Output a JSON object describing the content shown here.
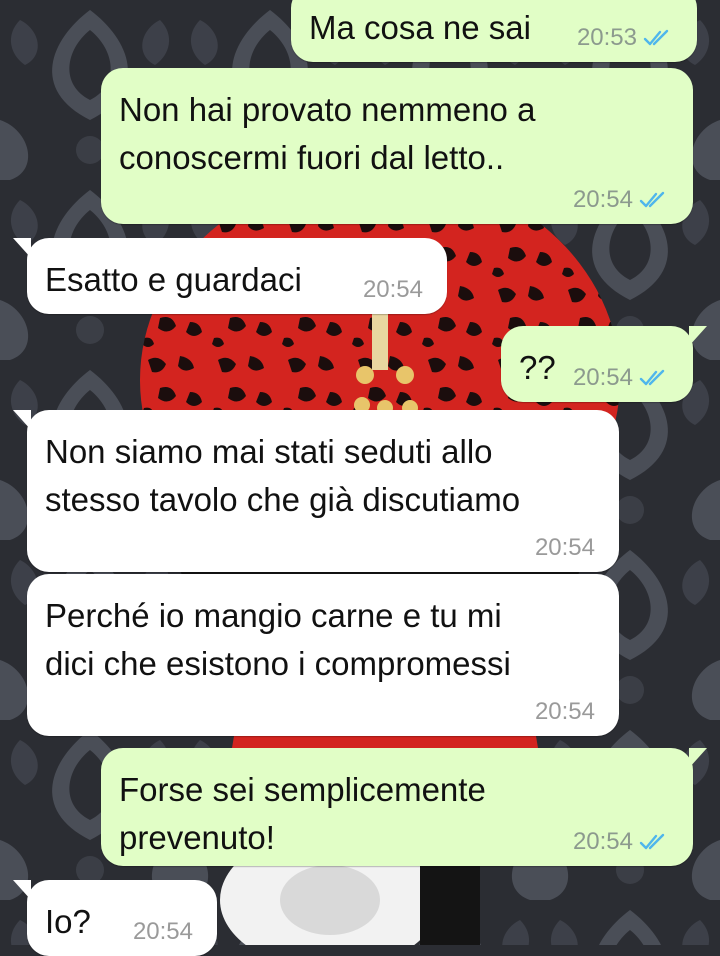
{
  "messages": [
    {
      "direction": "out",
      "text": "Ma cosa ne sai",
      "time": "20:53",
      "status": "read-double-check-icon"
    },
    {
      "direction": "out",
      "text": "Non hai provato nemmeno a\nconoscermi fuori dal letto..",
      "time": "20:54",
      "status": "read-double-check-icon"
    },
    {
      "direction": "in",
      "text": "Esatto e guardaci",
      "time": "20:54"
    },
    {
      "direction": "out",
      "text": "??",
      "time": "20:54",
      "status": "read-double-check-icon"
    },
    {
      "direction": "in",
      "text": "Non siamo mai stati seduti allo\nstesso tavolo che già discutiamo",
      "time": "20:54"
    },
    {
      "direction": "in",
      "text": "Perché io mangio carne e tu mi\ndici che esistono i compromessi",
      "time": "20:54"
    },
    {
      "direction": "out",
      "text": "Forse sei semplicemente\nprevenuto!",
      "time": "20:54",
      "status": "read-double-check-icon"
    },
    {
      "direction": "in",
      "text": "Io?",
      "time": "20:54"
    }
  ],
  "colors": {
    "outgoing_bubble": "#e1fec6",
    "incoming_bubble": "#ffffff",
    "read_ticks": "#4fb6ec",
    "wallpaper_base": "#2b2d33",
    "wallpaper_accent": "#d3241f"
  }
}
